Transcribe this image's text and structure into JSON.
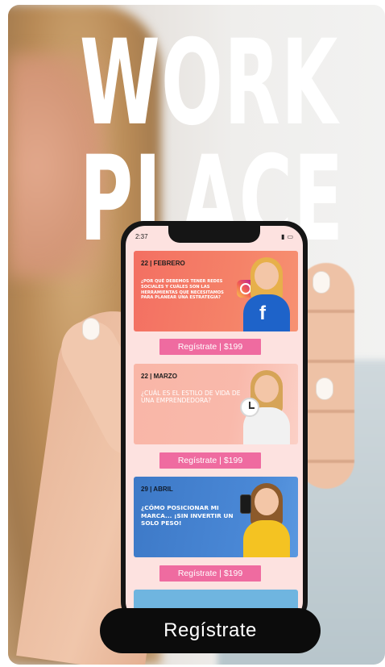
{
  "headline": {
    "line1": "WORK",
    "line2": "PLACE"
  },
  "phone": {
    "status_time": "2:37",
    "events": [
      {
        "date": "22 | FEBRERO",
        "text": "¿POR QUÉ DEBEMOS TENER REDES SOCIALES Y CUÁLES SON LAS HERRAMIENTAS QUE NECESITAMOS PARA PLANEAR UNA ESTRATEGIA?",
        "button": "Regístrate | $199"
      },
      {
        "date": "22 | MARZO",
        "text": "¿CUÁL ES EL ESTILO DE VIDA DE UNA EMPRENDEDORA?",
        "button": "Regístrate | $199"
      },
      {
        "date": "29 | ABRIL",
        "text": "¿CÓMO POSICIONAR MI MARCA... ¡SIN INVERTIR UN SOLO PESO!",
        "button": "Regístrate | $199"
      }
    ]
  },
  "cta": {
    "label": "Regístrate"
  },
  "colors": {
    "button_pink": "#ef6ba0",
    "card_coral": "#f36f62",
    "card_peach": "#f9b6a7",
    "card_blue": "#3d79c7",
    "screen_bg": "#fde2e0"
  }
}
